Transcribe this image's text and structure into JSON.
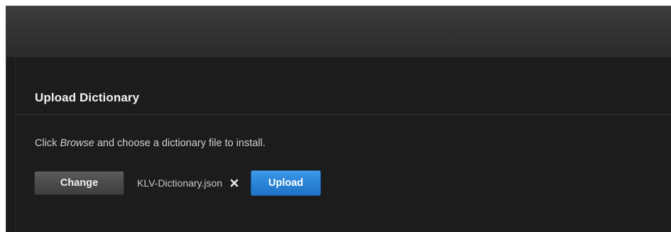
{
  "section": {
    "title": "Upload Dictionary"
  },
  "instruction": {
    "before": "Click ",
    "emphasis": "Browse",
    "after": " and choose a dictionary file to install."
  },
  "controls": {
    "change_label": "Change",
    "file_name": "KLV-Dictionary.json",
    "remove_icon": "close-x-icon",
    "upload_label": "Upload"
  },
  "colors": {
    "background": "#1c1c1c",
    "header_bar": "#333333",
    "accent_blue": "#2a84d8",
    "button_gray": "#4a4a4a",
    "text_primary": "#f2f2f2",
    "text_secondary": "#d0d0d0"
  }
}
